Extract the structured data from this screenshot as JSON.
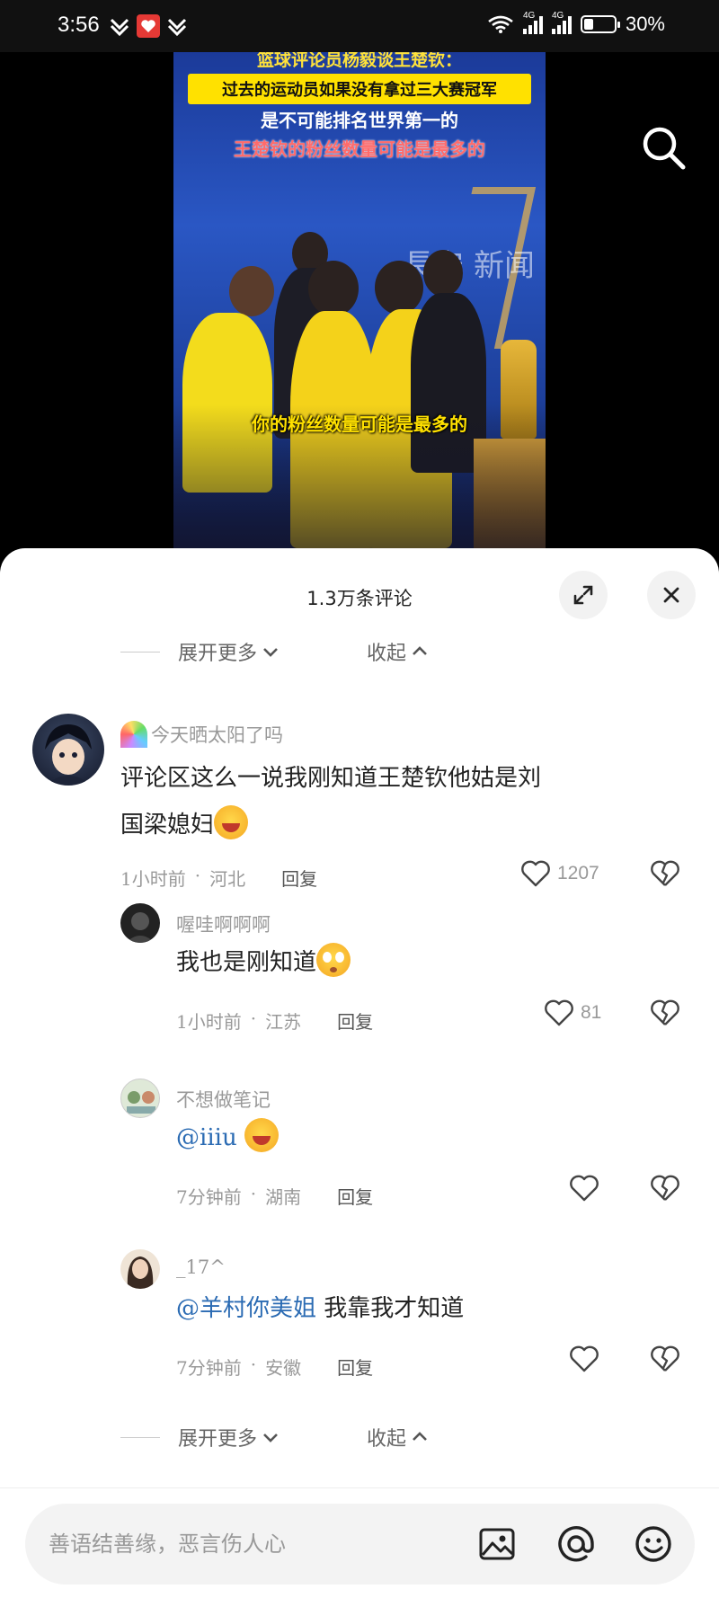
{
  "status_bar": {
    "time": "3:56",
    "battery": "30%",
    "battery_level": 0.3,
    "network_1": "4G",
    "network_2": "4G"
  },
  "video": {
    "caption_top": "篮球评论员杨毅谈王楚钦：",
    "caption_yellow": "过去的运动员如果没有拿过三大赛冠军",
    "caption_white": "是不可能排名世界第一的",
    "caption_red": "王楚钦的粉丝数量可能是最多的",
    "subtitle": "你的粉丝数量可能是最多的",
    "watermark": "長安 新闻"
  },
  "sheet": {
    "title": "1.3万条评论",
    "expand_more": "展开更多",
    "collapse": "收起"
  },
  "comments": [
    {
      "user": "今天晒太阳了吗",
      "text_line1": "评论区这么一说我刚知道王楚钦他姑是刘",
      "text_line2": "国梁媳妇",
      "time": "1小时前",
      "location": "河北",
      "reply": "回复",
      "likes": "1207"
    },
    {
      "user": "喔哇啊啊啊",
      "text": "我也是刚知道",
      "time": "1小时前",
      "location": "江苏",
      "reply": "回复",
      "likes": "81"
    },
    {
      "user": "不想做笔记",
      "mention": "@iiiu",
      "time": "7分钟前",
      "location": "湖南",
      "reply": "回复"
    },
    {
      "user": "_17^",
      "mention": "@羊村你美姐",
      "text": "我靠我才知道",
      "time": "7分钟前",
      "location": "安徽",
      "reply": "回复"
    }
  ],
  "input": {
    "placeholder": "善语结善缘，恶言伤人心"
  },
  "colors": {
    "accent_mention": "#2b6bb3",
    "caption_yellow": "#ffe100",
    "caption_red": "#ff6b6b"
  }
}
